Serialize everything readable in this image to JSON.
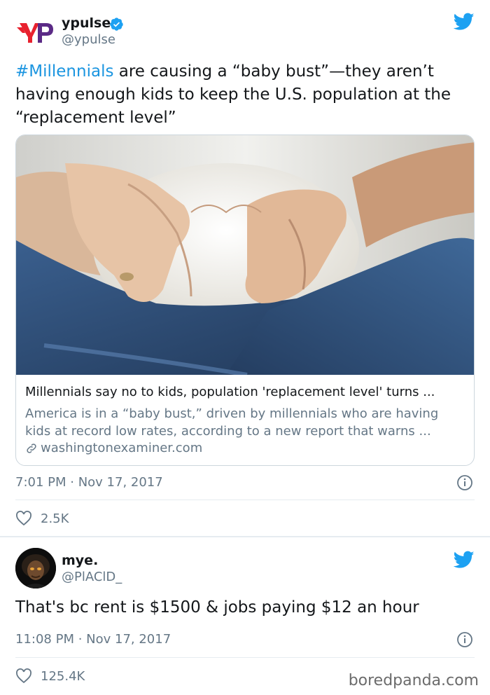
{
  "tweet1": {
    "display_name": "ypulse",
    "handle": "@ypulse",
    "verified": true,
    "text_hashtag": "#Millennials",
    "text_line1_rest": " are causing a “baby bust”—they aren’t",
    "text_line2": "having enough kids to keep the U.S. population at the",
    "text_line3": "“replacement level”",
    "card": {
      "title": "Millennials say no to kids, population 'replacement level' turns ...",
      "description_line1": "America is in a “baby bust,” driven by millennials who are having",
      "description_line2": "kids at record low rates, according to a new report that warns ...",
      "link": "washingtonexaminer.com"
    },
    "timestamp": "7:01 PM · Nov 17, 2017",
    "likes": "2.5K"
  },
  "tweet2": {
    "display_name": "mye.",
    "handle": "@PlAClD_",
    "text": "That's bc rent is $1500 & jobs paying $12 an hour",
    "timestamp": "11:08 PM · Nov 17, 2017",
    "likes": "125.4K"
  },
  "watermark": "boredpanda.com",
  "icons": {
    "brand": "twitter-bird-icon",
    "verified": "verified-badge-icon",
    "info": "info-icon",
    "like": "heart-icon",
    "link": "link-icon"
  },
  "colors": {
    "twitter_blue": "#1da1f2",
    "hashtag": "#1b95e0",
    "secondary_text": "#657786",
    "border": "#ccd6dd",
    "ypulse_red": "#e8212e",
    "ypulse_purple": "#5b2a86"
  }
}
